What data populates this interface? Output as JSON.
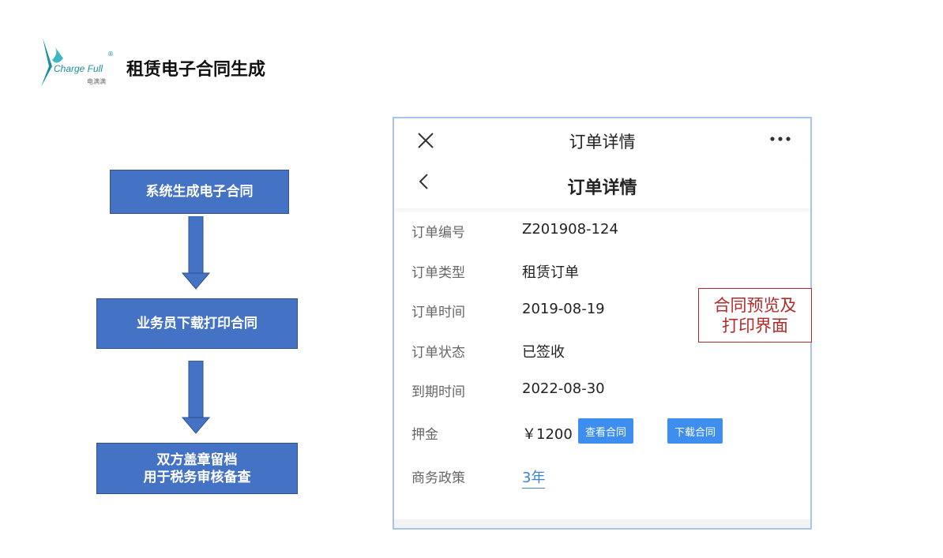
{
  "header": {
    "logo_text": "Charge Full",
    "logo_subtext": "电满满",
    "logo_reg": "®",
    "title": "租赁电子合同生成"
  },
  "flow": {
    "step1": "系统生成电子合同",
    "step2": "业务员下载打印合同",
    "step3_line1": "双方盖章留档",
    "step3_line2": "用于税务审核备查"
  },
  "phone": {
    "topbar_title": "订单详情",
    "navbar_title": "订单详情",
    "rows": [
      {
        "label": "订单编号",
        "value": "Z201908-124"
      },
      {
        "label": "订单类型",
        "value": "租赁订单"
      },
      {
        "label": "订单时间",
        "value": "2019-08-19"
      },
      {
        "label": "订单状态",
        "value": "已签收"
      },
      {
        "label": "到期时间",
        "value": "2022-08-30"
      },
      {
        "label": "押金",
        "value": "￥1200"
      },
      {
        "label": "商务政策",
        "value": "3年"
      }
    ],
    "view_contract_button": "查看合同",
    "download_contract_button": "下载合同"
  },
  "annotation": {
    "line1": "合同预览及",
    "line2": "打印界面"
  },
  "colors": {
    "flow_box": "#4472c4",
    "button": "#3e8ef0",
    "link": "#3b82d9",
    "annotation": "#b12a2a",
    "brand": "#1b8f9a"
  }
}
